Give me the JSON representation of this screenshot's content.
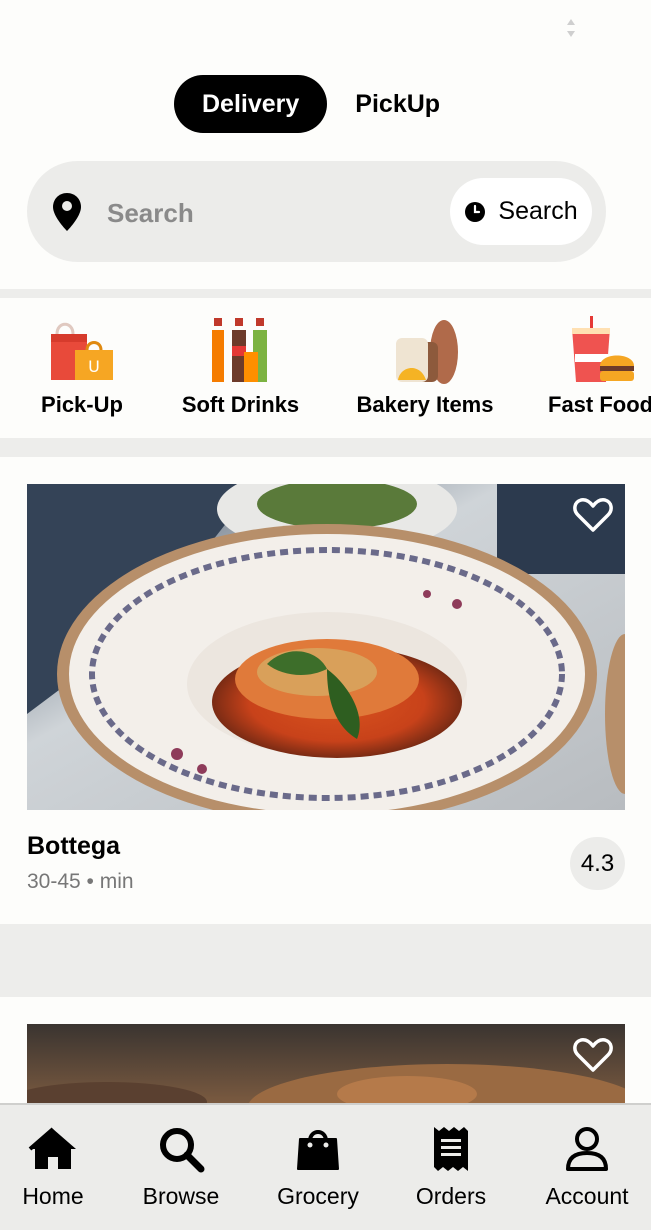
{
  "header": {
    "mode_toggle": {
      "delivery_label": "Delivery",
      "pickup_label": "PickUp",
      "active": "Delivery"
    }
  },
  "search": {
    "placeholder": "Search",
    "button_label": "Search",
    "location_icon": "location-pin-icon",
    "button_icon": "clock-icon"
  },
  "categories": [
    {
      "label": "Pick-Up",
      "icon": "shopping-bags-icon"
    },
    {
      "label": "Soft Drinks",
      "icon": "soda-bottles-icon"
    },
    {
      "label": "Bakery Items",
      "icon": "bread-icon"
    },
    {
      "label": "Fast Food",
      "icon": "burger-drink-icon"
    }
  ],
  "restaurants": [
    {
      "name": "Bottega",
      "time": "30-45 • min",
      "rating": "4.3",
      "favorite_icon": "heart-outline-icon"
    }
  ],
  "bottom_nav": [
    {
      "label": "Home",
      "icon": "home-icon"
    },
    {
      "label": "Browse",
      "icon": "search-icon"
    },
    {
      "label": "Grocery",
      "icon": "shopping-bag-icon"
    },
    {
      "label": "Orders",
      "icon": "receipt-icon"
    },
    {
      "label": "Account",
      "icon": "user-icon"
    }
  ],
  "colors": {
    "accent": "#000000",
    "surface": "#ececea",
    "background": "#fdfdfb",
    "muted_text": "#777777"
  }
}
